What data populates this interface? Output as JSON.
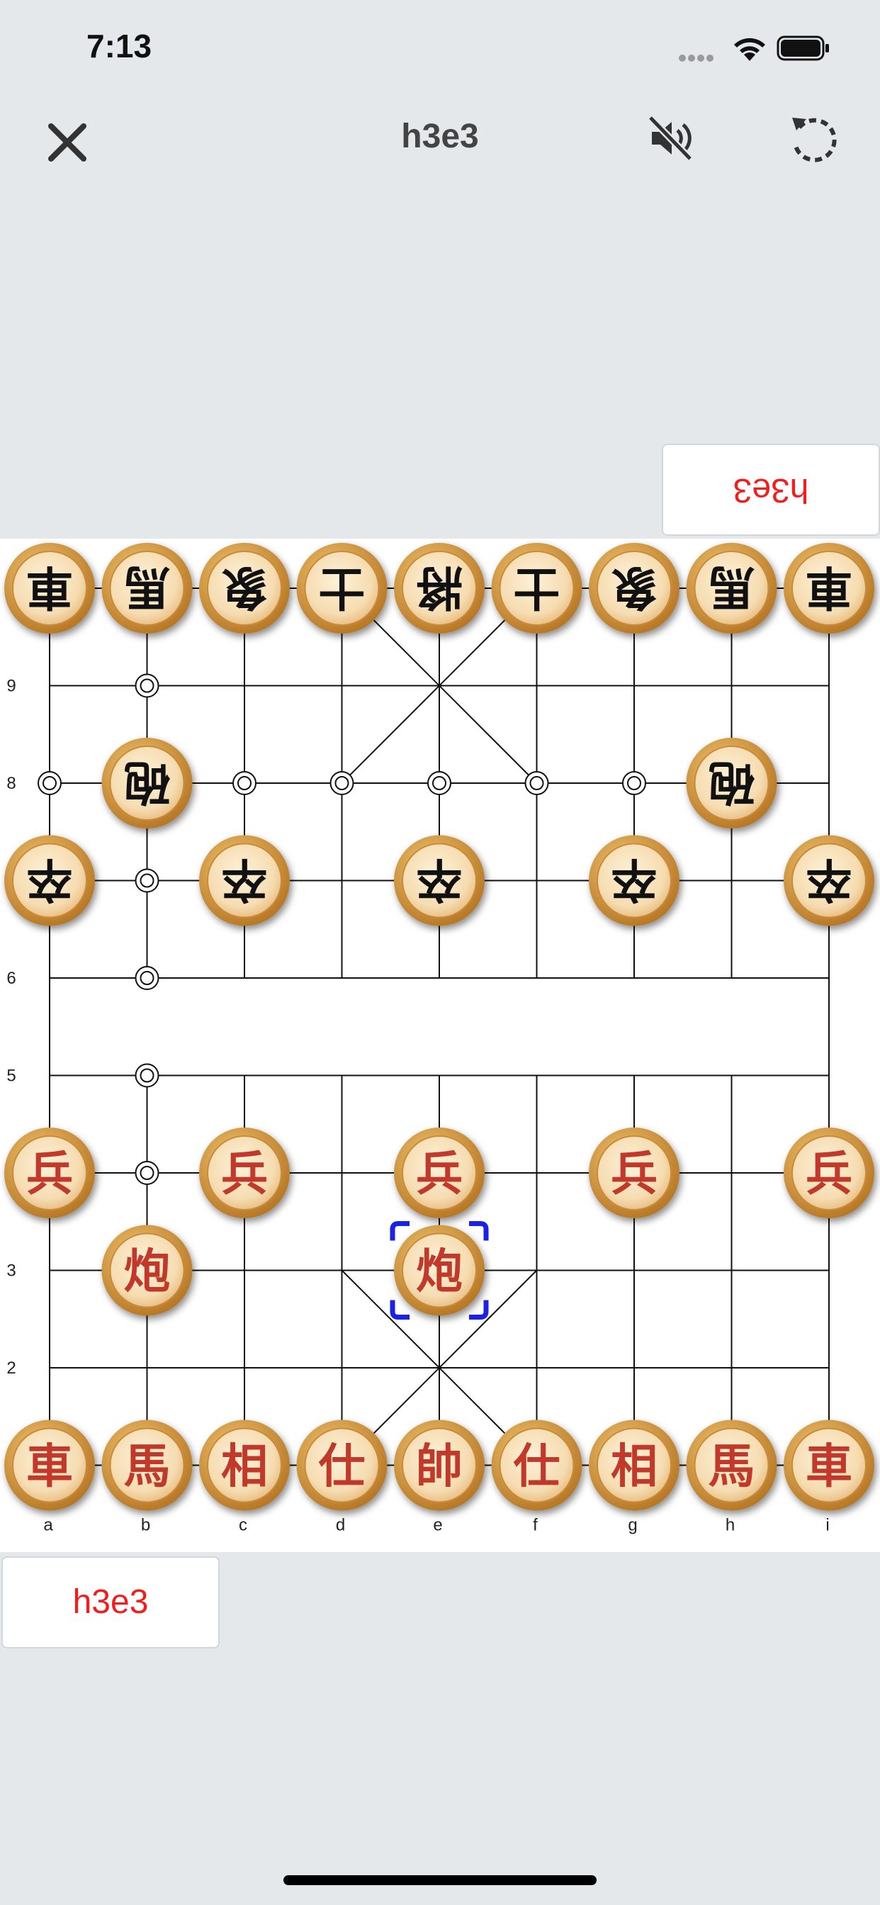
{
  "status_bar": {
    "time": "7:13"
  },
  "toolbar": {
    "title": "h3e3",
    "close_icon": "close-icon",
    "mute_icon": "speaker-muted-icon",
    "reset_icon": "rotate-reset-icon"
  },
  "opponent_last_move": "h3e3",
  "player_last_move": "h3e3",
  "board": {
    "files": [
      "a",
      "b",
      "c",
      "d",
      "e",
      "f",
      "g",
      "h",
      "i"
    ],
    "ranks": [
      "",
      "2",
      "3",
      "",
      "5",
      "6",
      "",
      "8",
      "9",
      ""
    ],
    "colors": {
      "red_piece_text": "#c0392b",
      "black_piece_text": "#111111",
      "selection": "#1a22e6",
      "piece_face": "#f6dcb1",
      "piece_rim": "#b06e1c"
    },
    "selected_square": "e3",
    "pieces": [
      {
        "file": "a",
        "rank": 10,
        "side": "black",
        "char": "車"
      },
      {
        "file": "b",
        "rank": 10,
        "side": "black",
        "char": "馬"
      },
      {
        "file": "c",
        "rank": 10,
        "side": "black",
        "char": "象"
      },
      {
        "file": "d",
        "rank": 10,
        "side": "black",
        "char": "士"
      },
      {
        "file": "e",
        "rank": 10,
        "side": "black",
        "char": "將"
      },
      {
        "file": "f",
        "rank": 10,
        "side": "black",
        "char": "士"
      },
      {
        "file": "g",
        "rank": 10,
        "side": "black",
        "char": "象"
      },
      {
        "file": "h",
        "rank": 10,
        "side": "black",
        "char": "馬"
      },
      {
        "file": "i",
        "rank": 10,
        "side": "black",
        "char": "車"
      },
      {
        "file": "b",
        "rank": 8,
        "side": "black",
        "char": "砲"
      },
      {
        "file": "h",
        "rank": 8,
        "side": "black",
        "char": "砲"
      },
      {
        "file": "a",
        "rank": 7,
        "side": "black",
        "char": "卒"
      },
      {
        "file": "c",
        "rank": 7,
        "side": "black",
        "char": "卒"
      },
      {
        "file": "e",
        "rank": 7,
        "side": "black",
        "char": "卒"
      },
      {
        "file": "g",
        "rank": 7,
        "side": "black",
        "char": "卒"
      },
      {
        "file": "i",
        "rank": 7,
        "side": "black",
        "char": "卒"
      },
      {
        "file": "a",
        "rank": 4,
        "side": "red",
        "char": "兵"
      },
      {
        "file": "c",
        "rank": 4,
        "side": "red",
        "char": "兵"
      },
      {
        "file": "e",
        "rank": 4,
        "side": "red",
        "char": "兵"
      },
      {
        "file": "g",
        "rank": 4,
        "side": "red",
        "char": "兵"
      },
      {
        "file": "i",
        "rank": 4,
        "side": "red",
        "char": "兵"
      },
      {
        "file": "b",
        "rank": 3,
        "side": "red",
        "char": "炮"
      },
      {
        "file": "e",
        "rank": 3,
        "side": "red",
        "char": "炮"
      },
      {
        "file": "a",
        "rank": 1,
        "side": "red",
        "char": "車"
      },
      {
        "file": "b",
        "rank": 1,
        "side": "red",
        "char": "馬"
      },
      {
        "file": "c",
        "rank": 1,
        "side": "red",
        "char": "相"
      },
      {
        "file": "d",
        "rank": 1,
        "side": "red",
        "char": "仕"
      },
      {
        "file": "e",
        "rank": 1,
        "side": "red",
        "char": "帥"
      },
      {
        "file": "f",
        "rank": 1,
        "side": "red",
        "char": "仕"
      },
      {
        "file": "g",
        "rank": 1,
        "side": "red",
        "char": "相"
      },
      {
        "file": "h",
        "rank": 1,
        "side": "red",
        "char": "馬"
      },
      {
        "file": "i",
        "rank": 1,
        "side": "red",
        "char": "車"
      }
    ],
    "markers": [
      "a8",
      "b9",
      "b8",
      "b7",
      "b6",
      "b5",
      "b4",
      "b1",
      "c8",
      "d8",
      "e8",
      "f8",
      "g8"
    ]
  }
}
